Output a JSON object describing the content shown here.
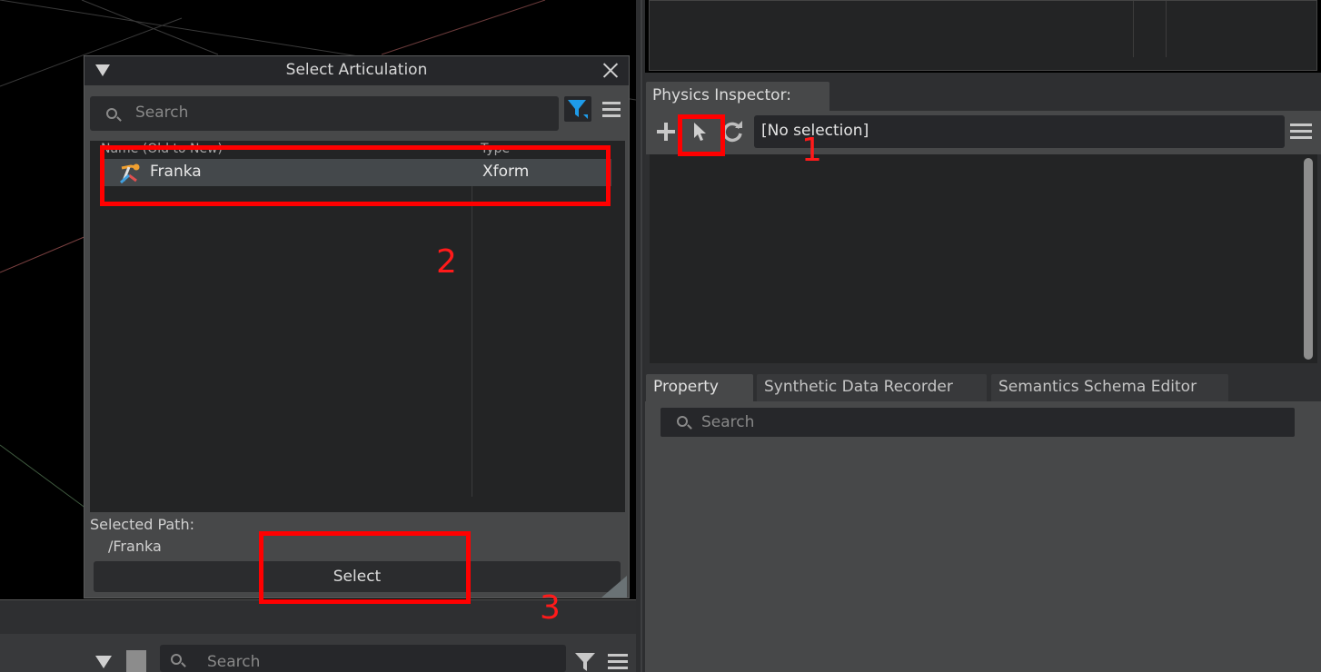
{
  "dialog": {
    "title": "Select Articulation",
    "search_placeholder": "Search",
    "columns": {
      "name": "Name (Old to New)",
      "type": "Type"
    },
    "rows": [
      {
        "name": "Franka",
        "type": "Xform",
        "icon": "articulation-icon"
      }
    ],
    "selected_path_label": "Selected Path:",
    "selected_path_value": "/Franka",
    "select_button": "Select",
    "filter_color": "#1e9be9"
  },
  "physics_inspector": {
    "tab_label": "Physics Inspector:",
    "selection_text": "[No selection]"
  },
  "property_tabs": [
    {
      "label": "Property",
      "active": true
    },
    {
      "label": "Synthetic Data Recorder",
      "active": false
    },
    {
      "label": "Semantics Schema Editor",
      "active": false
    }
  ],
  "property_search_placeholder": "Search",
  "stage": {
    "search_placeholder": "Search"
  },
  "annotations": {
    "step1": "1",
    "step2": "2",
    "step3": "3",
    "color": "#ff0000"
  }
}
